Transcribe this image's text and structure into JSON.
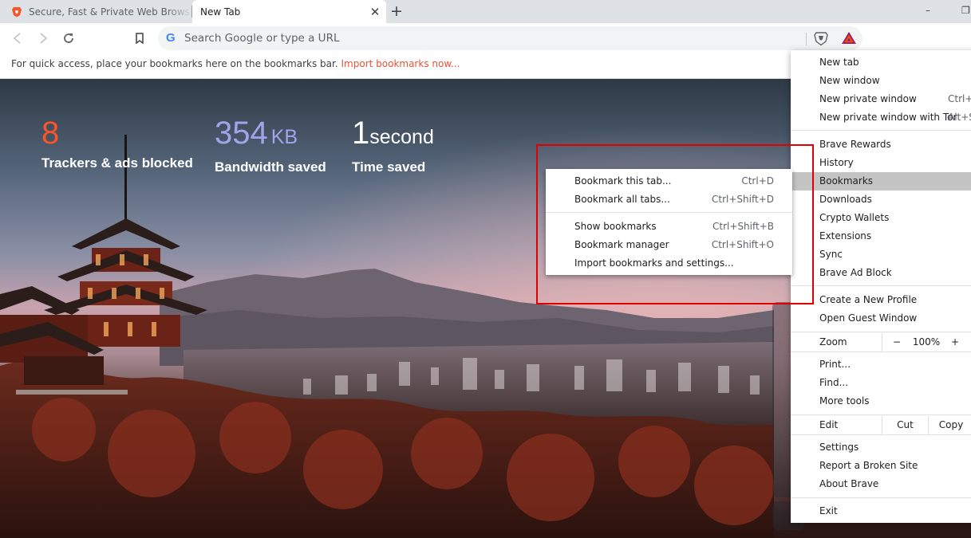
{
  "tabs": [
    {
      "title": "Secure, Fast & Private Web Browser with Adblocker | Brave",
      "active": false,
      "favicon": "brave-lion-icon"
    },
    {
      "title": "New Tab",
      "active": true
    }
  ],
  "new_tab_symbol": "+",
  "window_controls": {
    "minimize": "–",
    "maximize": "❐"
  },
  "toolbar": {
    "omnibox_placeholder": "Search Google or type a URL",
    "search_engine_icon": "G"
  },
  "bookmarks_bar": {
    "message": "For quick access, place your bookmarks here on the bookmarks bar.",
    "import_link": "Import bookmarks now..."
  },
  "stats": [
    {
      "value": "8",
      "unit": "",
      "label": "Trackers & ads blocked",
      "color": "#fb542b"
    },
    {
      "value": "354",
      "unit": "KB",
      "label": "Bandwidth saved",
      "color": "#a0a5eb"
    },
    {
      "value": "1",
      "unit": "second",
      "label": "Time saved",
      "color": "#ffffff"
    }
  ],
  "menu": {
    "new_tab": "New tab",
    "new_window": "New window",
    "new_private_window": {
      "label": "New private window",
      "shortcut": "Ctrl+Shift+N"
    },
    "new_private_window_tor": {
      "label": "New private window with Tor",
      "shortcut": "Alt+Shift+N"
    },
    "brave_rewards": "Brave Rewards",
    "history": "History",
    "bookmarks": "Bookmarks",
    "downloads": "Downloads",
    "crypto_wallets": "Crypto Wallets",
    "extensions": "Extensions",
    "sync": "Sync",
    "brave_ad_block": "Brave Ad Block",
    "create_profile": "Create a New Profile",
    "guest_window": "Open Guest Window",
    "zoom": {
      "label": "Zoom",
      "minus": "−",
      "value": "100%",
      "plus": "+"
    },
    "print": "Print...",
    "find": "Find...",
    "more_tools": "More tools",
    "edit": {
      "label": "Edit",
      "cut": "Cut",
      "copy": "Copy"
    },
    "settings": "Settings",
    "report_site": "Report a Broken Site",
    "about": "About Brave",
    "exit": "Exit"
  },
  "bookmarks_submenu": [
    {
      "label": "Bookmark this tab...",
      "shortcut": "Ctrl+D"
    },
    {
      "label": "Bookmark all tabs...",
      "shortcut": "Ctrl+Shift+D"
    },
    {
      "label": "Show bookmarks",
      "shortcut": "Ctrl+Shift+B"
    },
    {
      "label": "Bookmark manager",
      "shortcut": "Ctrl+Shift+O"
    },
    {
      "label": "Import bookmarks and settings...",
      "shortcut": ""
    }
  ],
  "colors": {
    "highlight_box": "#e00000",
    "brave_orange": "#fb542b",
    "menu_hover": "#c4c4c4"
  }
}
